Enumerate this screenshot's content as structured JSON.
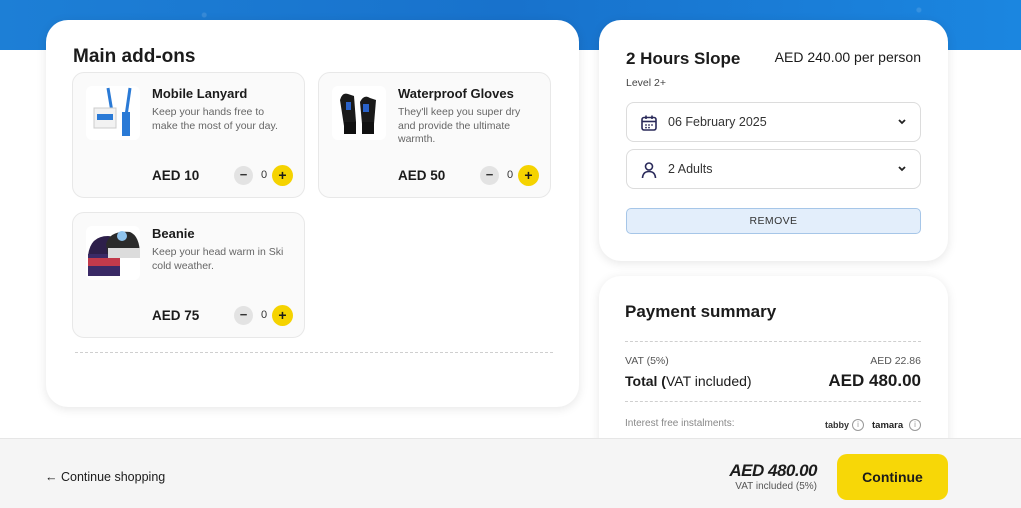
{
  "addons": {
    "title": "Main add-ons",
    "items": [
      {
        "name": "Mobile Lanyard",
        "desc": "Keep your hands free to make the most of your day.",
        "price": "AED 10",
        "qty": "0",
        "image": "lanyard-image"
      },
      {
        "name": "Waterproof Gloves",
        "desc": "They'll keep you super dry and provide the ultimate warmth.",
        "price": "AED 50",
        "qty": "0",
        "image": "gloves-image"
      },
      {
        "name": "Beanie",
        "desc": "Keep your head warm in Ski cold weather.",
        "price": "AED 75",
        "qty": "0",
        "image": "beanie-image"
      }
    ],
    "minus_symbol": "−",
    "plus_symbol": "+"
  },
  "booking": {
    "title": "2 Hours Slope",
    "price": "AED 240.00 per person",
    "level": "Level 2+",
    "date": "06 February 2025",
    "guests": "2 Adults",
    "remove_label": "REMOVE"
  },
  "payment": {
    "title": "Payment summary",
    "vat_label": "VAT (5%)",
    "vat_value": "AED 22.86",
    "total_label_bold": "Total (",
    "total_label_rest": "VAT included)",
    "total_value": "AED 480.00",
    "instalments_label": "Interest free instalments:",
    "tabby": "tabby",
    "tamara": "tamara"
  },
  "bottom_bar": {
    "continue_shopping": "← Continue shopping",
    "total": "AED 480.00",
    "vat_note": "VAT included (5%)",
    "continue_label": "Continue"
  },
  "colors": {
    "accent_yellow": "#f7d707",
    "banner_blue": "#1872cc",
    "remove_bg": "#e3eefb"
  }
}
